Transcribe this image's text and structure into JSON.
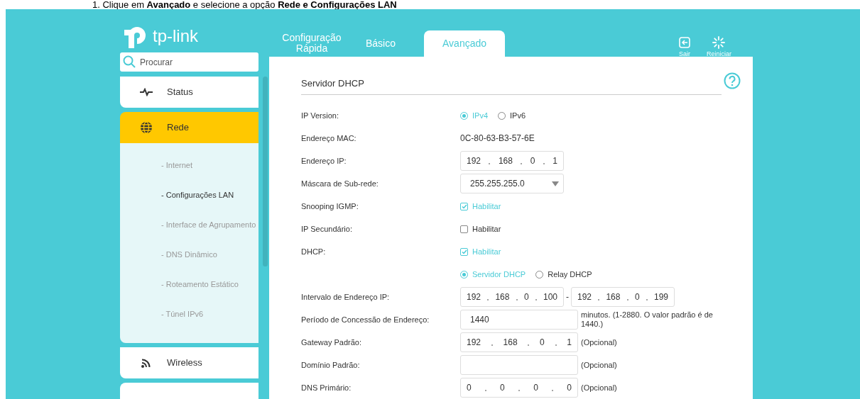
{
  "instruction": "1.   Clique em **Avançado** e selecione a opção **Rede e Configurações LAN**",
  "logo": {
    "text": "tp-link"
  },
  "tabs": [
    {
      "label": "Configuração Rápida",
      "selected": false
    },
    {
      "label": "Básico",
      "selected": false
    },
    {
      "label": "Avançado",
      "selected": true
    }
  ],
  "header_buttons": [
    {
      "kind": "logout",
      "label": "Sair"
    },
    {
      "kind": "reboot",
      "label": "Reiniciar"
    }
  ],
  "search": {
    "placeholder": "Procurar"
  },
  "sidebar": {
    "items": [
      {
        "kind": "status",
        "label": "Status",
        "selected": false
      },
      {
        "kind": "network",
        "label": "Rede",
        "selected": true,
        "children": [
          {
            "label": "- Internet",
            "selected": false
          },
          {
            "label": "- Configurações LAN",
            "selected": true
          },
          {
            "label": "- Interface de Agrupamento",
            "selected": false
          },
          {
            "label": "- DNS Dinâmico",
            "selected": false
          },
          {
            "label": "- Roteamento Estático",
            "selected": false
          },
          {
            "label": "- Túnel IPv6",
            "selected": false
          }
        ]
      },
      {
        "kind": "wireless",
        "label": "Wireless",
        "selected": false
      }
    ]
  },
  "section": {
    "title": "Servidor DHCP",
    "rows": [
      {
        "kind": "radio",
        "label": "IP Version:",
        "options": [
          {
            "label": "IPv4",
            "selected": true
          },
          {
            "label": "IPv6",
            "selected": false
          }
        ]
      },
      {
        "kind": "text",
        "label": "Endereço MAC:",
        "value": "0C-80-63-B3-57-6E"
      },
      {
        "kind": "ip",
        "label": "Endereço IP:",
        "octets": [
          "192",
          "168",
          "0",
          "1"
        ]
      },
      {
        "kind": "select",
        "label": "Máscara de Sub-rede:",
        "value": "255.255.255.0"
      },
      {
        "kind": "checkbox",
        "label": "Snooping IGMP:",
        "option": "Habilitar",
        "checked": true
      },
      {
        "kind": "checkbox",
        "label": "IP Secundário:",
        "option": "Habilitar",
        "checked": false
      },
      {
        "kind": "checkbox",
        "label": "DHCP:",
        "option": "Habilitar",
        "checked": true
      },
      {
        "kind": "radio",
        "options": [
          {
            "label": "Servidor DHCP",
            "selected": true
          },
          {
            "label": "Relay DHCP",
            "selected": false
          }
        ]
      },
      {
        "kind": "ip_range",
        "label": "Intervalo de Endereço IP:",
        "from": [
          "192",
          "168",
          "0",
          "100"
        ],
        "separator": "-",
        "to": [
          "192",
          "168",
          "0",
          "199"
        ]
      },
      {
        "kind": "input",
        "label": "Período de Concessão de Endereço:",
        "value": "1440",
        "note": "minutos. (1-2880. O valor padrão é de 1440.)"
      },
      {
        "kind": "ip",
        "label": "Gateway Padrão:",
        "octets": [
          "192",
          "168",
          "0",
          "1"
        ],
        "note": "(Opcional)",
        "wide": true
      },
      {
        "kind": "input",
        "label": "Domínio Padrão:",
        "note": "(Opcional)"
      },
      {
        "kind": "ip",
        "label": "DNS Primário:",
        "octets": [
          "0",
          "0",
          "0",
          "0"
        ],
        "note": "(Opcional)",
        "wide": true
      }
    ]
  }
}
